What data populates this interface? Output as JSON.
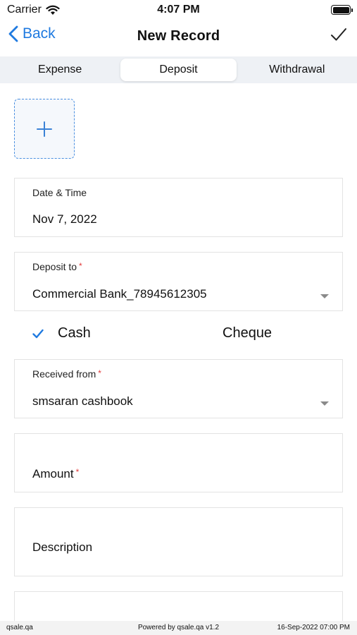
{
  "status_bar": {
    "carrier": "Carrier",
    "time": "4:07 PM"
  },
  "nav": {
    "back_label": "Back",
    "title": "New Record"
  },
  "tabs": [
    {
      "label": "Expense",
      "active": false
    },
    {
      "label": "Deposit",
      "active": true
    },
    {
      "label": "Withdrawal",
      "active": false
    }
  ],
  "form": {
    "date_time": {
      "label": "Date & Time",
      "value": "Nov 7, 2022"
    },
    "deposit_to": {
      "label": "Deposit to",
      "required_mark": "*",
      "value": "Commercial Bank_78945612305"
    },
    "payment_type": {
      "cash_label": "Cash",
      "cheque_label": "Cheque",
      "selected": "Cash"
    },
    "received_from": {
      "label": "Received from",
      "required_mark": "*",
      "value": "smsaran cashbook"
    },
    "amount": {
      "label": "Amount",
      "required_mark": "*"
    },
    "description": {
      "label": "Description"
    }
  },
  "footer": {
    "site": "qsale.qa",
    "powered_by": "Powered by qsale.qa v1.2",
    "datetime": "16-Sep-2022 07:00 PM"
  },
  "colors": {
    "accent": "#1f7ae0",
    "required": "#e23b3b",
    "segment_bg": "#eef1f5"
  }
}
